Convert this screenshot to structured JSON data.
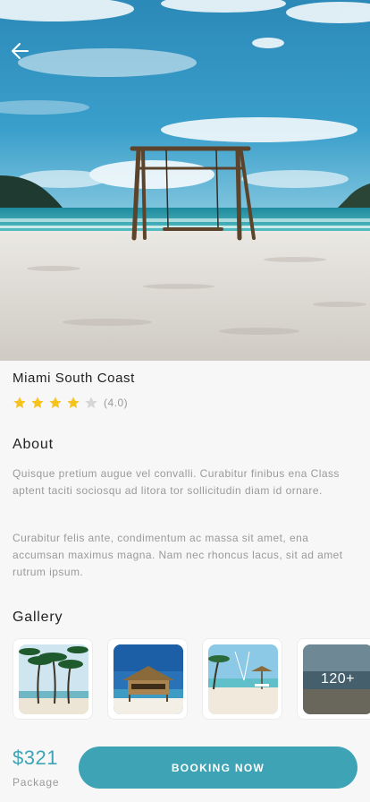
{
  "destination": {
    "title": "Miami South Coast",
    "rating": 4.0,
    "rating_max": 5,
    "rating_text": "(4.0)"
  },
  "about": {
    "heading": "About",
    "paragraphs": [
      "Quisque pretium augue vel convalli. Curabitur finibus ena Class aptent taciti sociosqu ad litora tor sollicitudin diam id ornare.",
      "Curabitur felis ante, condimentum ac massa sit amet, ena accumsan maximus magna. Nam nec rhoncus lacus, sit ad amet rutrum ipsum."
    ]
  },
  "gallery": {
    "heading": "Gallery",
    "more_label": "120+"
  },
  "booking": {
    "price": "$321",
    "price_caption": "Package",
    "button_label": "BOOKING NOW"
  },
  "colors": {
    "accent": "#3ea4b5",
    "star_filled": "#f6c21c",
    "star_empty": "#d6d6d6",
    "muted_text": "#9a9a9a"
  },
  "icons": {
    "back": "arrow-left-icon",
    "star": "star-icon"
  }
}
